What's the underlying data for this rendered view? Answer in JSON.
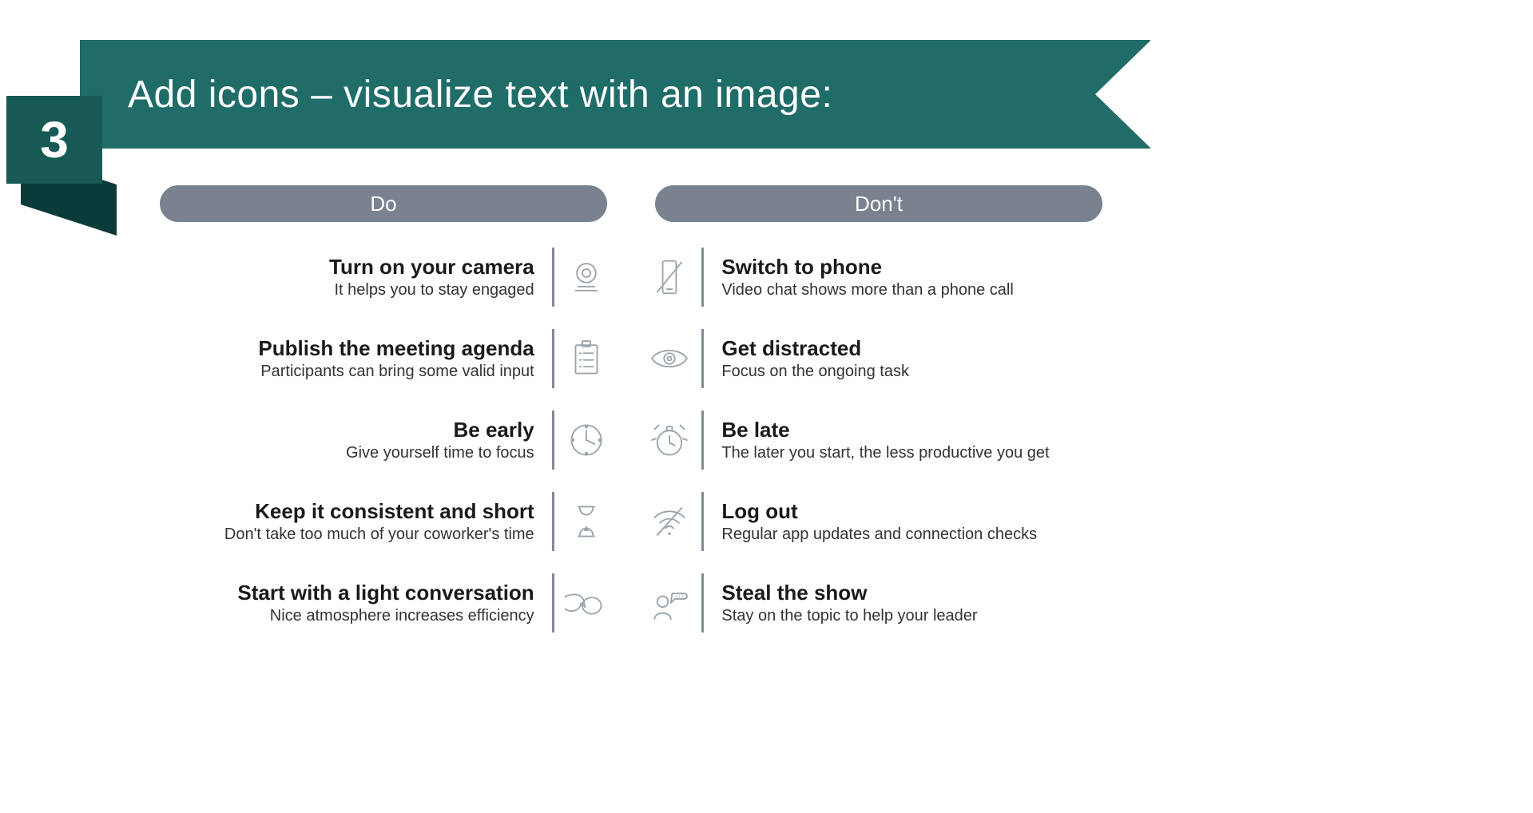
{
  "header": {
    "number": "3",
    "title": "Add icons – visualize text with an image:"
  },
  "columns": {
    "do_label": "Do",
    "dont_label": "Don't"
  },
  "rows": [
    {
      "do_title": "Turn on your camera",
      "do_desc": "It helps you to stay engaged",
      "do_icon": "camera-icon",
      "dont_title": "Switch to phone",
      "dont_desc": "Video chat shows more than a phone call",
      "dont_icon": "no-phone-icon"
    },
    {
      "do_title": "Publish the meeting agenda",
      "do_desc": "Participants can bring some valid input",
      "do_icon": "agenda-icon",
      "dont_title": "Get distracted",
      "dont_desc": "Focus on the ongoing task",
      "dont_icon": "eye-icon"
    },
    {
      "do_title": "Be early",
      "do_desc": "Give yourself time to focus",
      "do_icon": "clock-icon",
      "dont_title": "Be late",
      "dont_desc": "The later you start, the less productive you get",
      "dont_icon": "alarm-icon"
    },
    {
      "do_title": "Keep it consistent and short",
      "do_desc": "Don't take too much of your coworker's time",
      "do_icon": "hourglass-icon",
      "dont_title": "Log out",
      "dont_desc": "Regular app updates and connection checks",
      "dont_icon": "no-wifi-icon"
    },
    {
      "do_title": "Start with a light conversation",
      "do_desc": "Nice atmosphere increases efficiency",
      "do_icon": "chat-icon",
      "dont_title": "Steal the show",
      "dont_desc": "Stay on the topic to help your leader",
      "dont_icon": "speaking-icon"
    }
  ]
}
